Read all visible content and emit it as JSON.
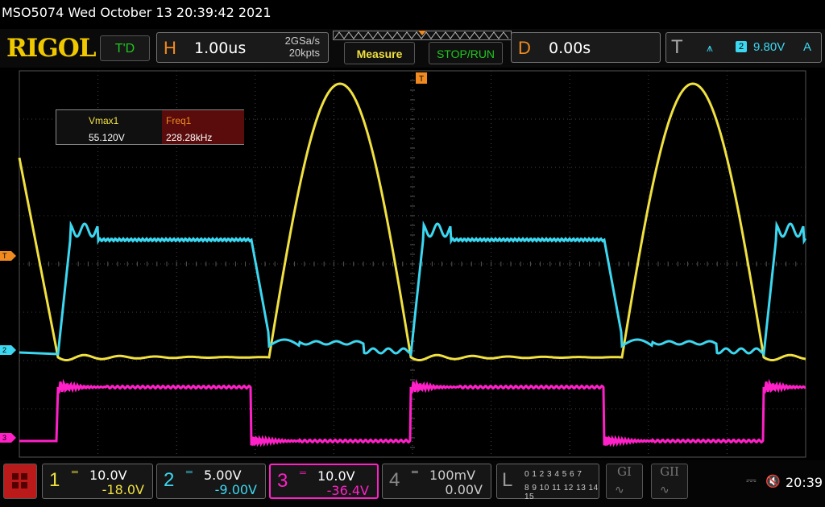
{
  "title": "MSO5074  Wed October 13 20:39:42 2021",
  "logo": "RIGOL",
  "td_label": "T'D",
  "horizontal": {
    "letter": "H",
    "scale": "1.00us",
    "sample_rate": "2GSa/s",
    "memory_depth": "20kpts"
  },
  "buttons": {
    "measure": "Measure",
    "stoprun": "STOP/RUN"
  },
  "delay": {
    "letter": "D",
    "value": "0.00s"
  },
  "trigger": {
    "letter": "T",
    "edge_icon": "rising-edge-icon",
    "source": "2",
    "level": "9.80V",
    "mode": "A"
  },
  "measurements": {
    "vmax_label": "Vmax1",
    "vmax_value": "55.120V",
    "freq_label": "Freq1",
    "freq_value": "228.28kHz"
  },
  "markers": {
    "trigger": "T",
    "ch2": "2",
    "ch3": "3"
  },
  "channels": [
    {
      "num": "1",
      "scale": "10.0V",
      "offset": "-18.0V",
      "color": "#f0e040"
    },
    {
      "num": "2",
      "scale": "5.00V",
      "offset": "-9.00V",
      "color": "#3cd7f0"
    },
    {
      "num": "3",
      "scale": "10.0V",
      "offset": "-36.4V",
      "color": "#ff20c8"
    },
    {
      "num": "4",
      "scale": "100mV",
      "offset": "0.00V",
      "color": "#888888"
    }
  ],
  "logic": {
    "label": "L",
    "row1": "0 1 2 3  4 5 6 7",
    "row2": "8 9 10 11 12 13 14 15"
  },
  "generators": {
    "g1": "GI",
    "g2": "GII"
  },
  "clock": "20:39"
}
